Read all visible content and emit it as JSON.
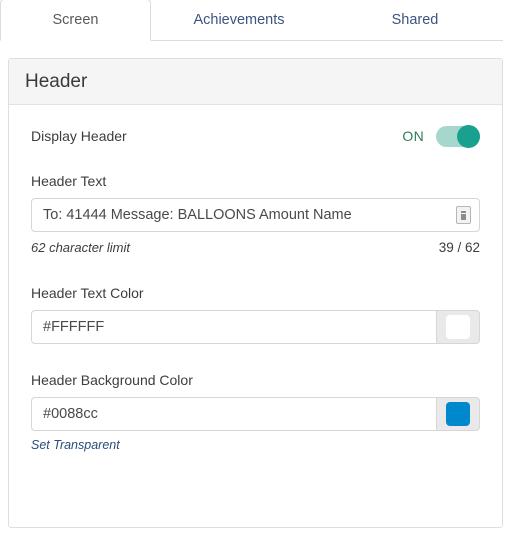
{
  "tabs": [
    {
      "label": "Screen",
      "active": true
    },
    {
      "label": "Achievements",
      "active": false
    },
    {
      "label": "Shared",
      "active": false
    }
  ],
  "panel": {
    "title": "Header",
    "display_header": {
      "label": "Display Header",
      "state_label": "ON"
    },
    "header_text": {
      "label": "Header Text",
      "value": "To: 41444 Message: BALLOONS Amount Name",
      "placeholder": "",
      "grip_icon": "resize-grip-icon",
      "limit_note": "62 character limit",
      "counter": "39 / 62"
    },
    "header_text_color": {
      "label": "Header Text Color",
      "value": "#FFFFFF",
      "swatch": "#FFFFFF"
    },
    "header_background_color": {
      "label": "Header Background Color",
      "value": "#0088cc",
      "swatch": "#0088cc",
      "transparent_link": "Set Transparent"
    }
  },
  "colors": {
    "toggle_track": "#a5d7cd",
    "toggle_knob": "#19a08f",
    "on_text": "#2e7d56",
    "tab_inactive_text": "#3c5480",
    "tab_active_text": "#5a5a5a",
    "link": "#2c4a7c"
  }
}
